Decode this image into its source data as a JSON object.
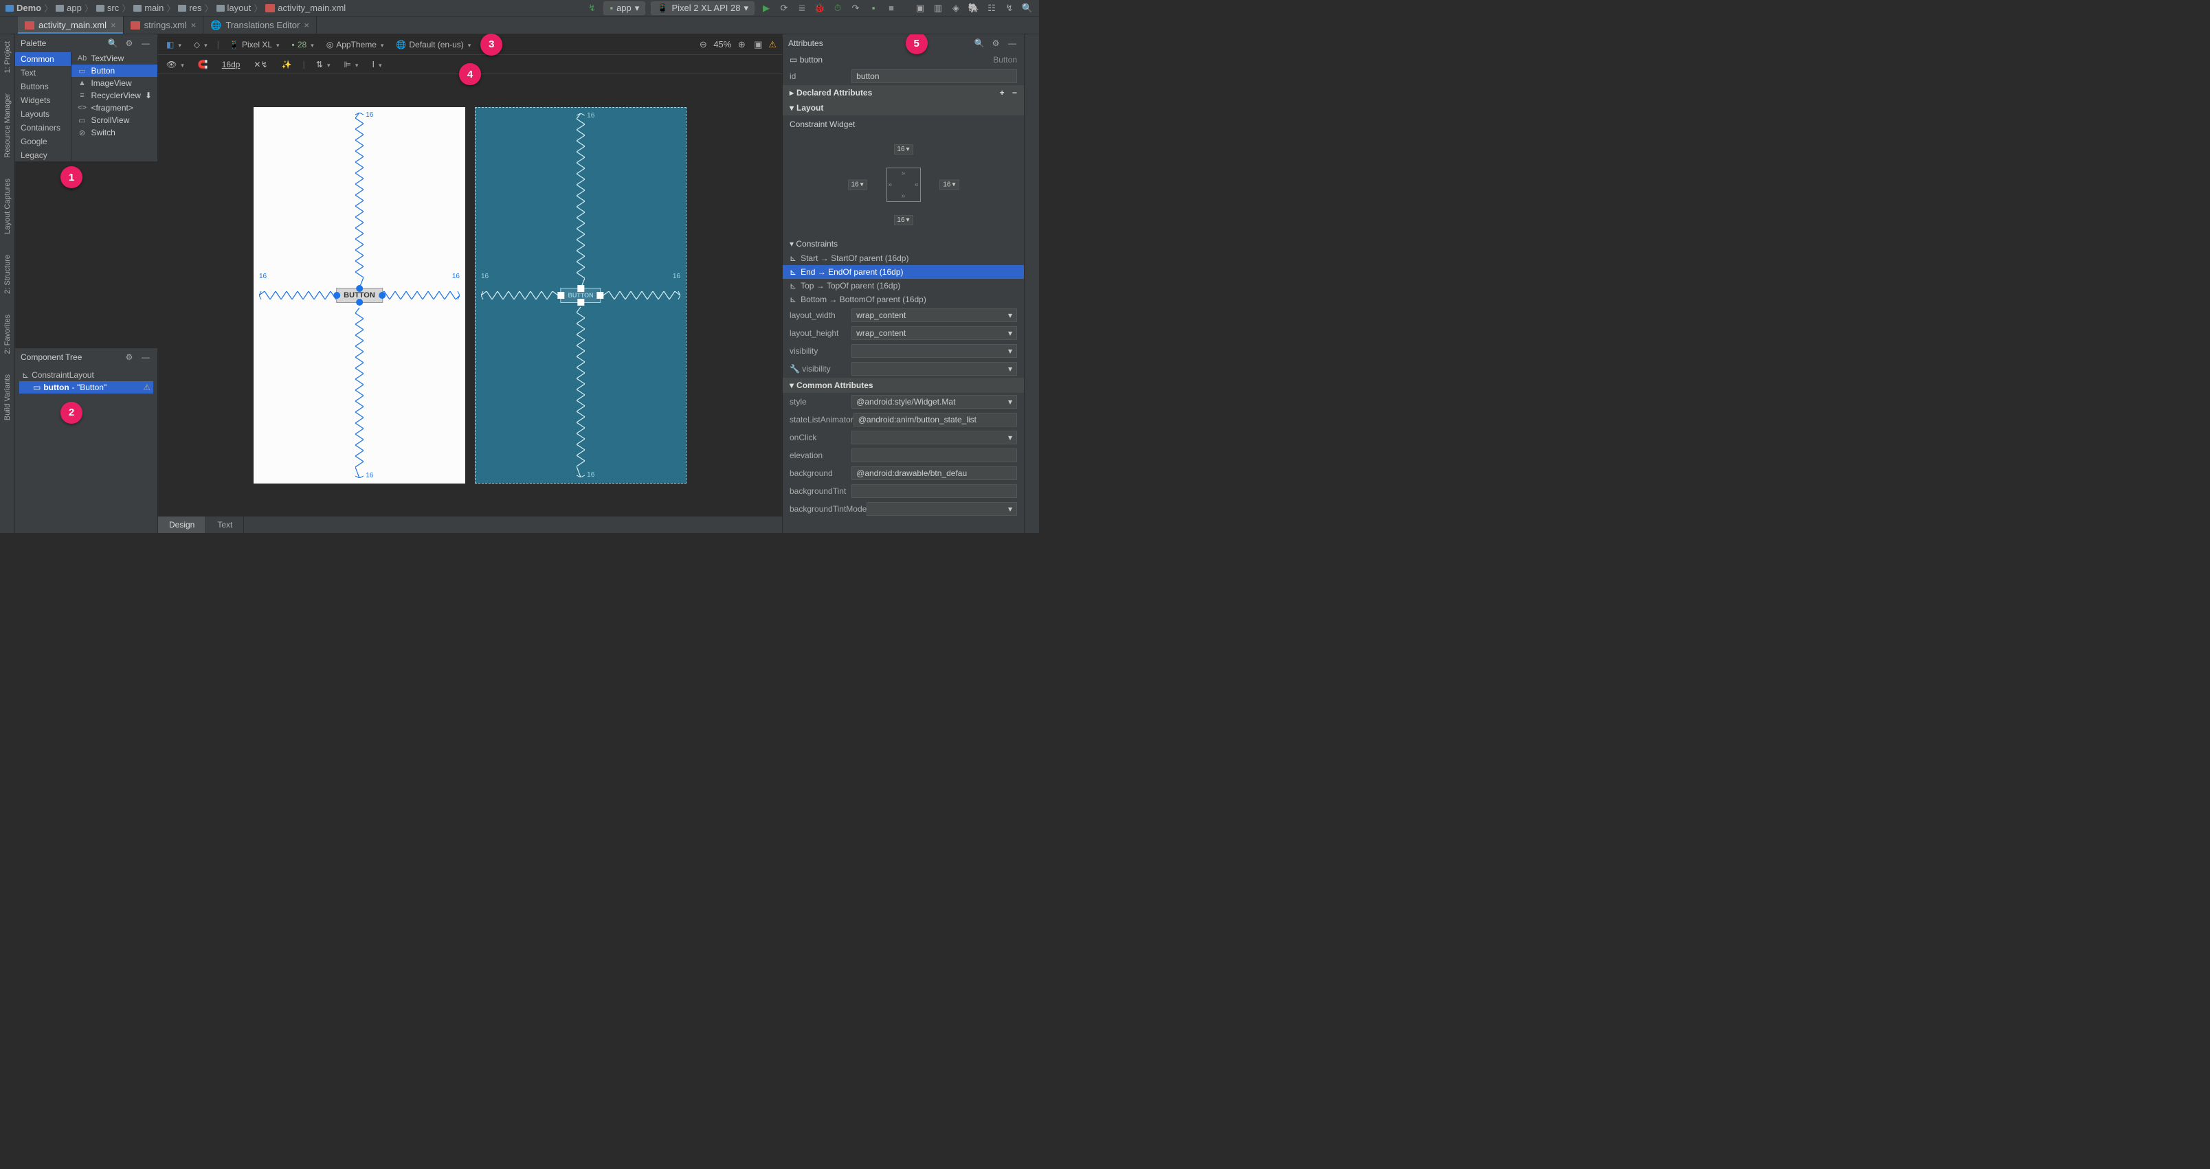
{
  "breadcrumb": [
    "Demo",
    "app",
    "src",
    "main",
    "res",
    "layout",
    "activity_main.xml"
  ],
  "toolbar_right": {
    "module": "app",
    "device": "Pixel 2 XL API 28"
  },
  "tabs": [
    {
      "label": "activity_main.xml",
      "active": true,
      "closeable": true
    },
    {
      "label": "strings.xml",
      "active": false,
      "closeable": true
    },
    {
      "label": "Translations Editor",
      "active": false,
      "closeable": true
    }
  ],
  "side_left": [
    "1: Project",
    "Resource Manager",
    "Layout Captures",
    "2: Structure",
    "2: Favorites",
    "Build Variants"
  ],
  "palette": {
    "title": "Palette",
    "categories": [
      "Common",
      "Text",
      "Buttons",
      "Widgets",
      "Layouts",
      "Containers",
      "Google",
      "Legacy"
    ],
    "active_cat": "Common",
    "items": [
      {
        "glyph": "Ab",
        "label": "TextView"
      },
      {
        "glyph": "▭",
        "label": "Button",
        "active": true
      },
      {
        "glyph": "▲",
        "label": "ImageView"
      },
      {
        "glyph": "≡",
        "label": "RecyclerView",
        "dl": true
      },
      {
        "glyph": "<>",
        "label": "<fragment>"
      },
      {
        "glyph": "▭",
        "label": "ScrollView"
      },
      {
        "glyph": "⊘",
        "label": "Switch"
      }
    ]
  },
  "component_tree": {
    "title": "Component Tree",
    "root": "ConstraintLayout",
    "child_id": "button",
    "child_text": "- \"Button\""
  },
  "editor_toolbar": {
    "device": "Pixel XL",
    "api": "28",
    "theme": "AppTheme",
    "locale": "Default (en-us)",
    "zoom": "45%"
  },
  "sub_toolbar": {
    "nudge": "16dp"
  },
  "canvas": {
    "button_label": "BUTTON",
    "margin": "16"
  },
  "attributes": {
    "title": "Attributes",
    "type_label": "button",
    "type_right": "Button",
    "id_label": "id",
    "id_value": "button",
    "sections": {
      "declared": "Declared Attributes",
      "layout": "Layout",
      "cw_label": "Constraint Widget",
      "cw_vals": {
        "t": "16",
        "l": "16",
        "r": "16",
        "b": "16"
      },
      "constraints_title": "Constraints",
      "constraints": [
        {
          "txt": "Start → StartOf parent (16dp)",
          "sel": false
        },
        {
          "txt": "End → EndOf parent (16dp)",
          "sel": true
        },
        {
          "txt": "Top → TopOf parent (16dp)",
          "sel": false
        },
        {
          "txt": "Bottom → BottomOf parent (16dp)",
          "sel": false
        }
      ],
      "layout_width": {
        "lbl": "layout_width",
        "val": "wrap_content"
      },
      "layout_height": {
        "lbl": "layout_height",
        "val": "wrap_content"
      },
      "visibility": {
        "lbl": "visibility",
        "val": ""
      },
      "tools_vis": {
        "lbl": "visibility",
        "val": ""
      },
      "common_title": "Common Attributes",
      "common": [
        {
          "lbl": "style",
          "val": "@android:style/Widget.Mat"
        },
        {
          "lbl": "stateListAnimator",
          "val": "@android:anim/button_state_list"
        },
        {
          "lbl": "onClick",
          "val": ""
        },
        {
          "lbl": "elevation",
          "val": ""
        },
        {
          "lbl": "background",
          "val": "@android:drawable/btn_defau"
        },
        {
          "lbl": "backgroundTint",
          "val": ""
        },
        {
          "lbl": "backgroundTintMode",
          "val": ""
        }
      ]
    }
  },
  "bottom_tabs": [
    {
      "label": "Design",
      "active": true
    },
    {
      "label": "Text",
      "active": false
    }
  ],
  "callouts": {
    "1": "1",
    "2": "2",
    "3": "3",
    "4": "4",
    "5": "5"
  }
}
